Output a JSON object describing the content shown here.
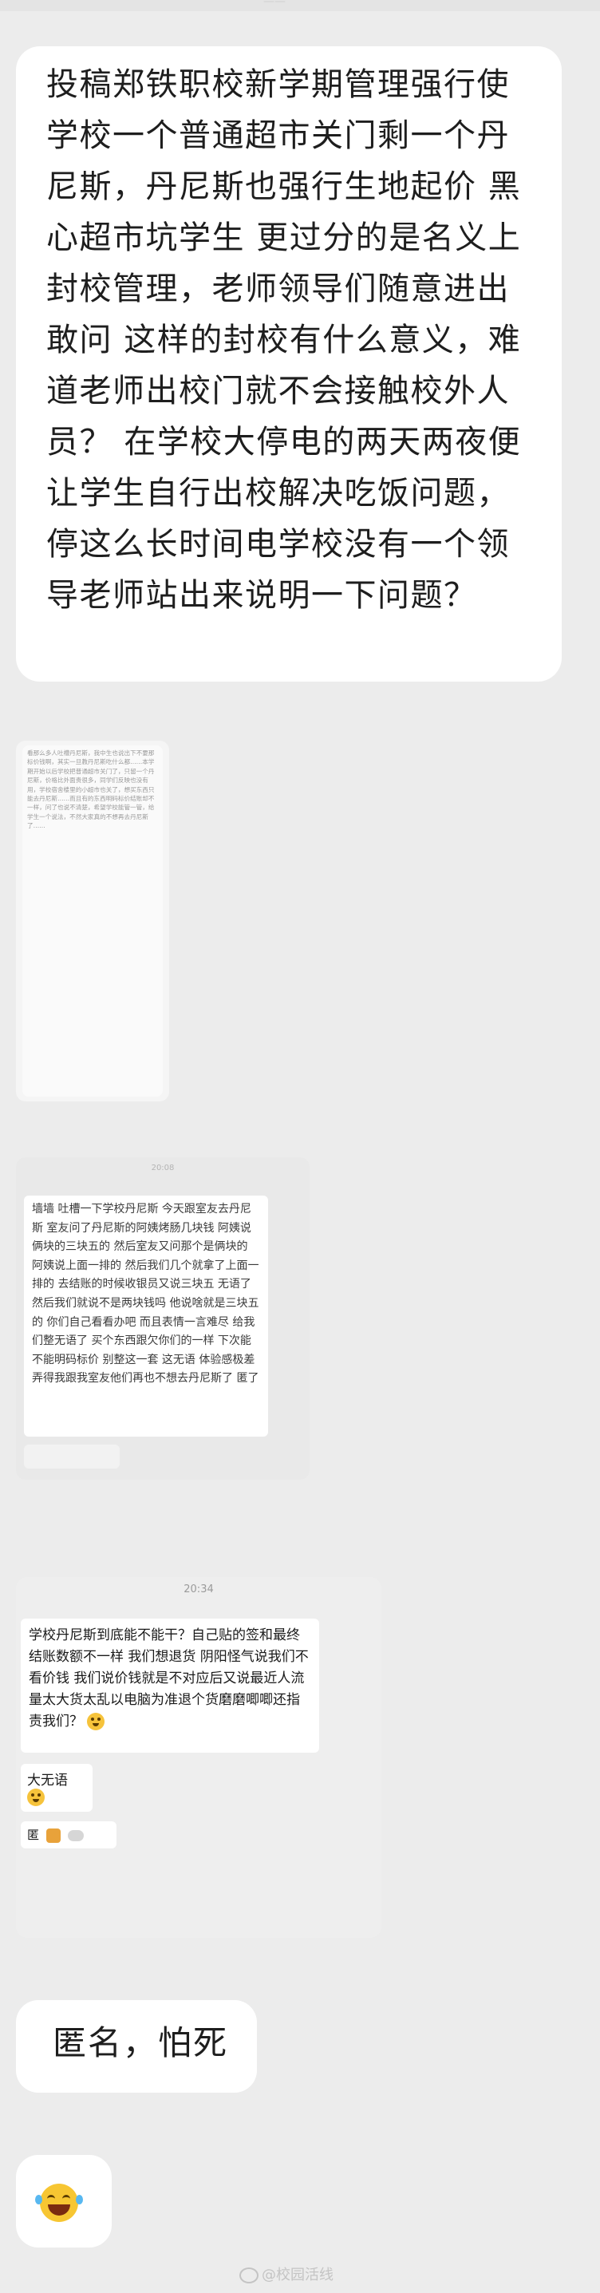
{
  "top_status": {
    "text": "——"
  },
  "bubble_main": {
    "text": "投稿郑铁职校新学期管理强行使学校一个普通超市关门剩一个丹尼斯，丹尼斯也强行生地起价 黑心超市坑学生 更过分的是名义上封校管理，老师领导们随意进出敢问 这样的封校有什么意义，难道老师出校门就不会接触校外人员？ 在学校大停电的两天两夜便让学生自行出校解决吃饭问题，停这么长时间电学校没有一个领导老师站出来说明一下问题？"
  },
  "screenshot_1": {
    "text": "看那么多人吐槽丹尼斯，我中生也说出下不要那标价钱啊，其实一旦教丹尼斯吃什么都……本学期开始以后学校把普通超市关门了，只留一个丹尼斯，价格比外面贵很多，同学们反映也没有用，学校宿舍楼里的小超市也关了，想买东西只能去丹尼斯……而且有的东西明码标价结账却不一样，问了也说不清楚，希望学校能管一管，给学生一个说法，不然大家真的不想再去丹尼斯了……"
  },
  "screenshot_2": {
    "time": "20:08",
    "text": "墙墙 吐槽一下学校丹尼斯 今天跟室友去丹尼斯 室友问了丹尼斯的阿姨烤肠几块钱 阿姨说俩块的三块五的 然后室友又问那个是俩块的 阿姨说上面一排的 然后我们几个就拿了上面一排的 去结账的时候收银员又说三块五 无语了 然后我们就说不是两块钱吗 他说啥就是三块五的 你们自己看看办吧 而且表情一言难尽 给我们整无语了 买个东西跟欠你们的一样 下次能不能明码标价 别整这一套 这无语 体验感极差 弄得我跟我室友他们再也不想去丹尼斯了 匿了"
  },
  "screenshot_3": {
    "time": "20:34",
    "text": "学校丹尼斯到底能不能干？自己贴的签和最终结账数额不一样 我们想退货 阴阳怪气说我们不看价钱 我们说价钱就是不对应后又说最近人流量太大货太乱以电脑为准退个货磨磨唧唧还指责我们？",
    "reply": "大无语",
    "anon": "匿"
  },
  "bubble_anon": {
    "text": "匿名，怕死"
  },
  "bubble_emoji": {
    "icon": "laughing-tears-icon"
  },
  "watermark": {
    "text": "@校园活线"
  }
}
